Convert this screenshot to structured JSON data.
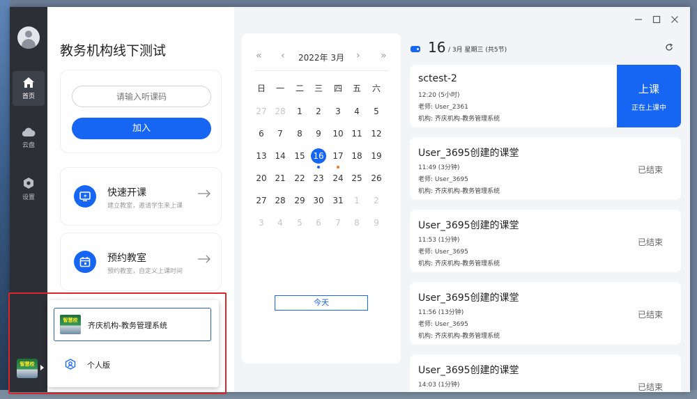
{
  "rail": {
    "items": [
      {
        "label": "首页",
        "icon": "home-icon",
        "active": true
      },
      {
        "label": "云盘",
        "icon": "cloud-icon",
        "active": false
      },
      {
        "label": "设置",
        "icon": "settings-icon",
        "active": false
      }
    ],
    "logo_text": "智慧校"
  },
  "left_panel": {
    "title": "教务机构线下测试",
    "join": {
      "placeholder": "请输入听课码",
      "button": "加入"
    },
    "features": [
      {
        "title": "快速开课",
        "desc": "建立教室，邀请学生来上课",
        "icon": "monitor-flash-icon"
      },
      {
        "title": "预约教室",
        "desc": "预约教室，自定义上课时间",
        "icon": "calendar-icon"
      }
    ]
  },
  "calendar": {
    "month_label": "2022年 3月",
    "weekdays": [
      "日",
      "一",
      "二",
      "三",
      "四",
      "五",
      "六"
    ],
    "weeks": [
      [
        {
          "d": "27",
          "m": true
        },
        {
          "d": "28",
          "m": true
        },
        {
          "d": "1"
        },
        {
          "d": "2"
        },
        {
          "d": "3"
        },
        {
          "d": "4"
        },
        {
          "d": "5"
        }
      ],
      [
        {
          "d": "6"
        },
        {
          "d": "7"
        },
        {
          "d": "8"
        },
        {
          "d": "9"
        },
        {
          "d": "10"
        },
        {
          "d": "11"
        },
        {
          "d": "12"
        }
      ],
      [
        {
          "d": "13"
        },
        {
          "d": "14"
        },
        {
          "d": "15"
        },
        {
          "d": "16",
          "today": true,
          "dot": "#1765f3"
        },
        {
          "d": "17",
          "dot": "#f07a2a"
        },
        {
          "d": "18"
        },
        {
          "d": "19"
        }
      ],
      [
        {
          "d": "20"
        },
        {
          "d": "21"
        },
        {
          "d": "22"
        },
        {
          "d": "23"
        },
        {
          "d": "24"
        },
        {
          "d": "25"
        },
        {
          "d": "26"
        }
      ],
      [
        {
          "d": "27"
        },
        {
          "d": "28"
        },
        {
          "d": "29"
        },
        {
          "d": "30"
        },
        {
          "d": "31"
        },
        {
          "d": "1",
          "m": true
        },
        {
          "d": "2",
          "m": true
        }
      ],
      [
        {
          "d": "3",
          "m": true
        },
        {
          "d": "4",
          "m": true
        },
        {
          "d": "5",
          "m": true
        },
        {
          "d": "6",
          "m": true
        },
        {
          "d": "7",
          "m": true
        },
        {
          "d": "8",
          "m": true
        },
        {
          "d": "9",
          "m": true
        }
      ]
    ],
    "today_button": "今天"
  },
  "schedule": {
    "day": "16",
    "sub": "/ 3月   星期三 (共5节)",
    "lessons": [
      {
        "title": "sctest-2",
        "time": "12:20   (5小时)",
        "teacher": "老师: User_2361",
        "org": "机构: 齐庆机构-教务管理系统",
        "live": {
          "main": "上课",
          "sub": "正在上课中"
        }
      },
      {
        "title": "User_3695创建的课堂",
        "time": "11:49   (3分钟)",
        "teacher": "老师: User_3695",
        "org": "机构: 齐庆机构-教务管理系统",
        "status": "已结束"
      },
      {
        "title": "User_3695创建的课堂",
        "time": "11:53   (1分钟)",
        "teacher": "老师: User_3695",
        "org": "机构: 齐庆机构-教务管理系统",
        "status": "已结束"
      },
      {
        "title": "User_3695创建的课堂",
        "time": "11:56   (13分钟)",
        "teacher": "老师: User_3695",
        "org": "机构: 齐庆机构-教务管理系统",
        "status": "已结束"
      },
      {
        "title": "User_3695创建的课堂",
        "time": "14:03   (1分钟)",
        "teacher": "",
        "org": "",
        "status": "已结束"
      }
    ]
  },
  "org_menu": {
    "org_name": "齐庆机构-教务管理系统",
    "personal": "个人版"
  },
  "colors": {
    "accent": "#1765f3",
    "highlight": "#d9262c",
    "rail": "#2c2f36"
  }
}
